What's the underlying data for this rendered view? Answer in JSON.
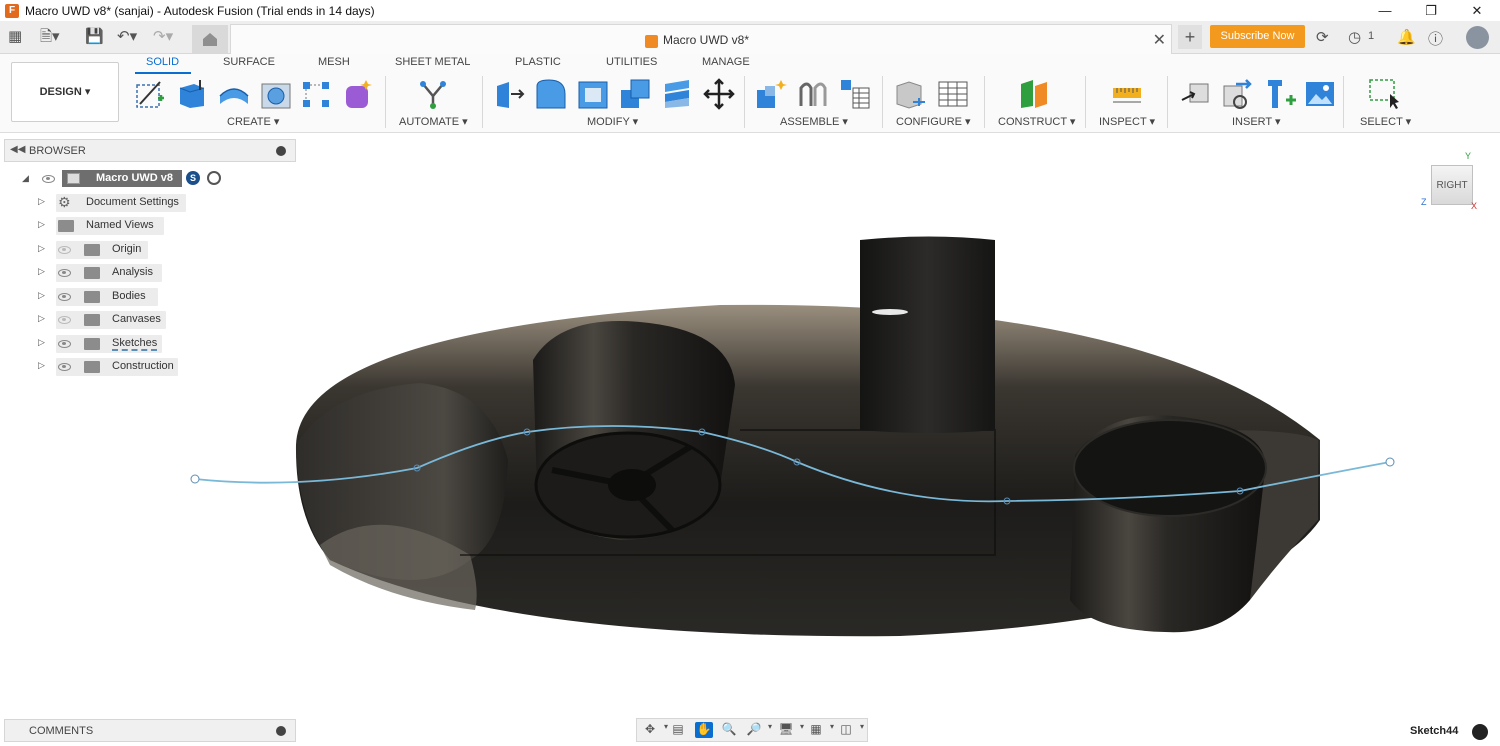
{
  "window": {
    "title": "Macro UWD v8* (sanjai) - Autodesk Fusion (Trial ends in 14 days)",
    "controls": [
      "minimize",
      "restore",
      "close"
    ]
  },
  "quick_access": {
    "document_tab_title": "Macro UWD v8*",
    "subscribe_label": "Subscribe Now",
    "job_count": "1",
    "icons": [
      "grid-icon",
      "file-icon",
      "save-icon",
      "undo-icon",
      "redo-icon",
      "home-icon",
      "new-tab-icon",
      "online-status-icon",
      "job-status-icon",
      "notifications-icon",
      "help-icon",
      "user-avatar"
    ]
  },
  "ribbon": {
    "workspace": "DESIGN",
    "tabs": [
      {
        "label": "SOLID",
        "active": true
      },
      {
        "label": "SURFACE",
        "active": false
      },
      {
        "label": "MESH",
        "active": false
      },
      {
        "label": "SHEET METAL",
        "active": false
      },
      {
        "label": "PLASTIC",
        "active": false
      },
      {
        "label": "UTILITIES",
        "active": false
      },
      {
        "label": "MANAGE",
        "active": false
      }
    ],
    "groups": [
      {
        "label": "CREATE",
        "tools": [
          "create-sketch-icon",
          "extrude-icon",
          "revolve-icon",
          "hole-icon",
          "pattern-icon",
          "form-icon"
        ]
      },
      {
        "label": "AUTOMATE",
        "tools": [
          "automate-icon"
        ]
      },
      {
        "label": "MODIFY",
        "tools": [
          "press-pull-icon",
          "fillet-icon",
          "shell-icon",
          "combine-icon",
          "offset-face-icon",
          "move-icon"
        ]
      },
      {
        "label": "ASSEMBLE",
        "tools": [
          "new-component-icon",
          "joint-icon",
          "bom-icon"
        ]
      },
      {
        "label": "CONFIGURE",
        "tools": [
          "configure-icon",
          "table-icon"
        ]
      },
      {
        "label": "CONSTRUCT",
        "tools": [
          "offset-plane-icon"
        ]
      },
      {
        "label": "INSPECT",
        "tools": [
          "measure-icon"
        ]
      },
      {
        "label": "INSERT",
        "tools": [
          "insert-derive-icon",
          "insert-mesh-icon",
          "insert-mcmaster-icon",
          "insert-canvas-icon"
        ]
      },
      {
        "label": "SELECT",
        "tools": [
          "select-box-icon"
        ]
      }
    ]
  },
  "browser": {
    "title": "BROWSER",
    "root": "Macro UWD v8",
    "items": [
      {
        "label": "Document Settings",
        "icon": "gear-icon",
        "visible": null
      },
      {
        "label": "Named Views",
        "icon": "folder-icon",
        "visible": null
      },
      {
        "label": "Origin",
        "icon": "folder-icon",
        "visible": false
      },
      {
        "label": "Analysis",
        "icon": "folder-icon",
        "visible": true
      },
      {
        "label": "Bodies",
        "icon": "folder-icon",
        "visible": true
      },
      {
        "label": "Canvases",
        "icon": "folder-icon",
        "visible": false
      },
      {
        "label": "Sketches",
        "icon": "folder-icon",
        "visible": true
      },
      {
        "label": "Construction",
        "icon": "folder-icon",
        "visible": true
      }
    ]
  },
  "viewcube": {
    "face": "RIGHT",
    "axis_y": "Y",
    "axis_z": "Z",
    "axis_x": "X"
  },
  "comments": {
    "title": "COMMENTS"
  },
  "status": {
    "active_sketch": "Sketch44"
  },
  "colors": {
    "accent": "#0a6ed1",
    "subscribe": "#f39a1e",
    "sketch_line": "#7ab8d8"
  }
}
